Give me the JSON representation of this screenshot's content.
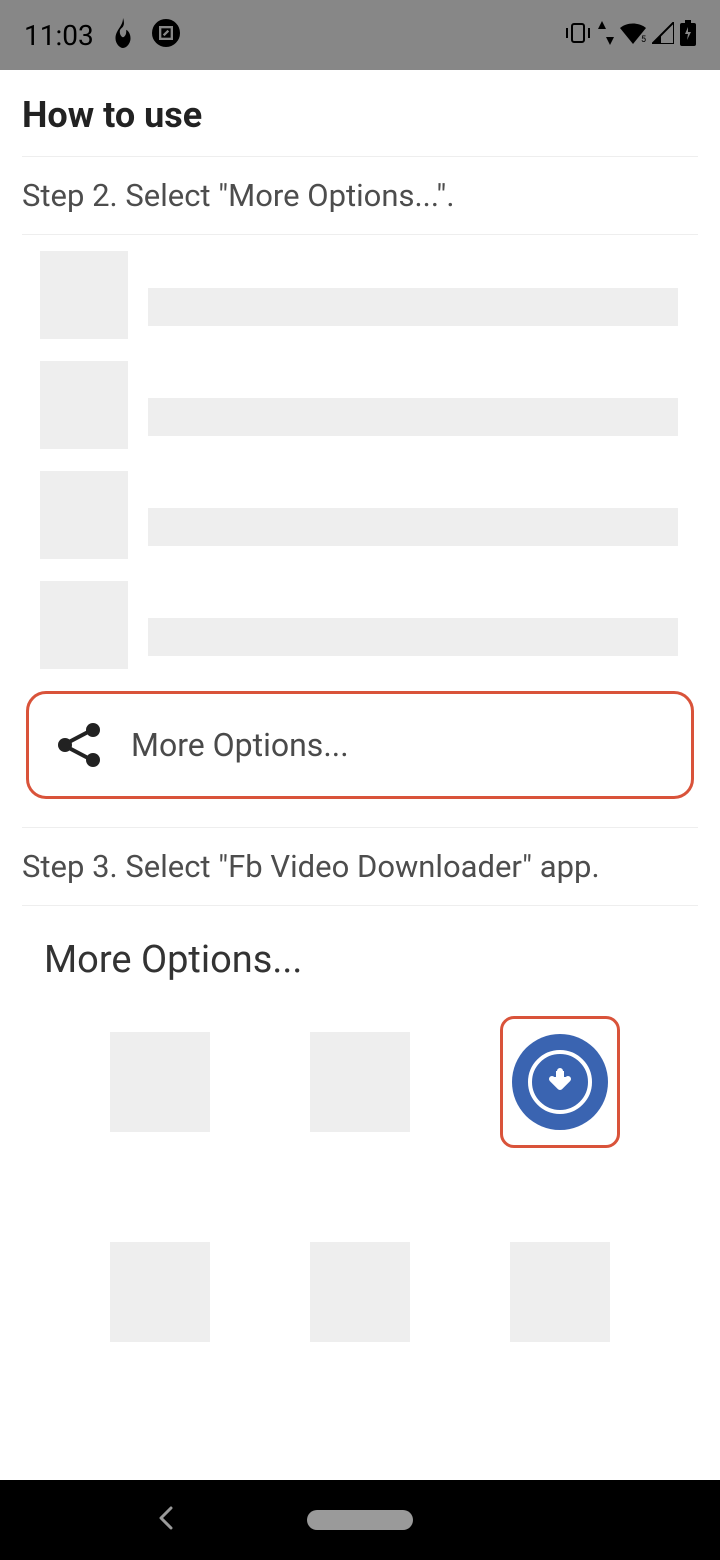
{
  "statusBar": {
    "time": "11:03"
  },
  "page": {
    "title": "How to use"
  },
  "step2": {
    "text": "Step 2. Select \"More Options...\"."
  },
  "moreOptionsButton": {
    "label": "More Options..."
  },
  "step3": {
    "text": "Step 3. Select \"Fb Video Downloader\" app."
  },
  "shareSheet": {
    "title": "More Options..."
  },
  "colors": {
    "highlight": "#d9533a",
    "downloadIcon": "#3a64b1",
    "placeholder": "#eeeeee"
  }
}
